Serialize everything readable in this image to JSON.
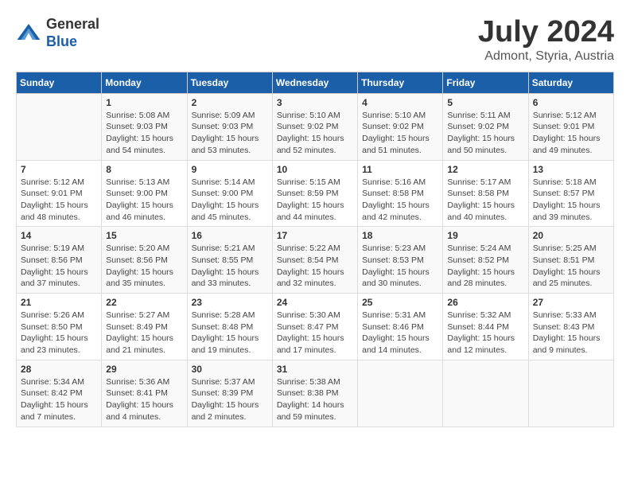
{
  "logo": {
    "general": "General",
    "blue": "Blue"
  },
  "title": "July 2024",
  "subtitle": "Admont, Styria, Austria",
  "columns": [
    "Sunday",
    "Monday",
    "Tuesday",
    "Wednesday",
    "Thursday",
    "Friday",
    "Saturday"
  ],
  "weeks": [
    [
      {
        "day": "",
        "info": ""
      },
      {
        "day": "1",
        "info": "Sunrise: 5:08 AM\nSunset: 9:03 PM\nDaylight: 15 hours and 54 minutes."
      },
      {
        "day": "2",
        "info": "Sunrise: 5:09 AM\nSunset: 9:03 PM\nDaylight: 15 hours and 53 minutes."
      },
      {
        "day": "3",
        "info": "Sunrise: 5:10 AM\nSunset: 9:02 PM\nDaylight: 15 hours and 52 minutes."
      },
      {
        "day": "4",
        "info": "Sunrise: 5:10 AM\nSunset: 9:02 PM\nDaylight: 15 hours and 51 minutes."
      },
      {
        "day": "5",
        "info": "Sunrise: 5:11 AM\nSunset: 9:02 PM\nDaylight: 15 hours and 50 minutes."
      },
      {
        "day": "6",
        "info": "Sunrise: 5:12 AM\nSunset: 9:01 PM\nDaylight: 15 hours and 49 minutes."
      }
    ],
    [
      {
        "day": "7",
        "info": "Sunrise: 5:12 AM\nSunset: 9:01 PM\nDaylight: 15 hours and 48 minutes."
      },
      {
        "day": "8",
        "info": "Sunrise: 5:13 AM\nSunset: 9:00 PM\nDaylight: 15 hours and 46 minutes."
      },
      {
        "day": "9",
        "info": "Sunrise: 5:14 AM\nSunset: 9:00 PM\nDaylight: 15 hours and 45 minutes."
      },
      {
        "day": "10",
        "info": "Sunrise: 5:15 AM\nSunset: 8:59 PM\nDaylight: 15 hours and 44 minutes."
      },
      {
        "day": "11",
        "info": "Sunrise: 5:16 AM\nSunset: 8:58 PM\nDaylight: 15 hours and 42 minutes."
      },
      {
        "day": "12",
        "info": "Sunrise: 5:17 AM\nSunset: 8:58 PM\nDaylight: 15 hours and 40 minutes."
      },
      {
        "day": "13",
        "info": "Sunrise: 5:18 AM\nSunset: 8:57 PM\nDaylight: 15 hours and 39 minutes."
      }
    ],
    [
      {
        "day": "14",
        "info": "Sunrise: 5:19 AM\nSunset: 8:56 PM\nDaylight: 15 hours and 37 minutes."
      },
      {
        "day": "15",
        "info": "Sunrise: 5:20 AM\nSunset: 8:56 PM\nDaylight: 15 hours and 35 minutes."
      },
      {
        "day": "16",
        "info": "Sunrise: 5:21 AM\nSunset: 8:55 PM\nDaylight: 15 hours and 33 minutes."
      },
      {
        "day": "17",
        "info": "Sunrise: 5:22 AM\nSunset: 8:54 PM\nDaylight: 15 hours and 32 minutes."
      },
      {
        "day": "18",
        "info": "Sunrise: 5:23 AM\nSunset: 8:53 PM\nDaylight: 15 hours and 30 minutes."
      },
      {
        "day": "19",
        "info": "Sunrise: 5:24 AM\nSunset: 8:52 PM\nDaylight: 15 hours and 28 minutes."
      },
      {
        "day": "20",
        "info": "Sunrise: 5:25 AM\nSunset: 8:51 PM\nDaylight: 15 hours and 25 minutes."
      }
    ],
    [
      {
        "day": "21",
        "info": "Sunrise: 5:26 AM\nSunset: 8:50 PM\nDaylight: 15 hours and 23 minutes."
      },
      {
        "day": "22",
        "info": "Sunrise: 5:27 AM\nSunset: 8:49 PM\nDaylight: 15 hours and 21 minutes."
      },
      {
        "day": "23",
        "info": "Sunrise: 5:28 AM\nSunset: 8:48 PM\nDaylight: 15 hours and 19 minutes."
      },
      {
        "day": "24",
        "info": "Sunrise: 5:30 AM\nSunset: 8:47 PM\nDaylight: 15 hours and 17 minutes."
      },
      {
        "day": "25",
        "info": "Sunrise: 5:31 AM\nSunset: 8:46 PM\nDaylight: 15 hours and 14 minutes."
      },
      {
        "day": "26",
        "info": "Sunrise: 5:32 AM\nSunset: 8:44 PM\nDaylight: 15 hours and 12 minutes."
      },
      {
        "day": "27",
        "info": "Sunrise: 5:33 AM\nSunset: 8:43 PM\nDaylight: 15 hours and 9 minutes."
      }
    ],
    [
      {
        "day": "28",
        "info": "Sunrise: 5:34 AM\nSunset: 8:42 PM\nDaylight: 15 hours and 7 minutes."
      },
      {
        "day": "29",
        "info": "Sunrise: 5:36 AM\nSunset: 8:41 PM\nDaylight: 15 hours and 4 minutes."
      },
      {
        "day": "30",
        "info": "Sunrise: 5:37 AM\nSunset: 8:39 PM\nDaylight: 15 hours and 2 minutes."
      },
      {
        "day": "31",
        "info": "Sunrise: 5:38 AM\nSunset: 8:38 PM\nDaylight: 14 hours and 59 minutes."
      },
      {
        "day": "",
        "info": ""
      },
      {
        "day": "",
        "info": ""
      },
      {
        "day": "",
        "info": ""
      }
    ]
  ]
}
